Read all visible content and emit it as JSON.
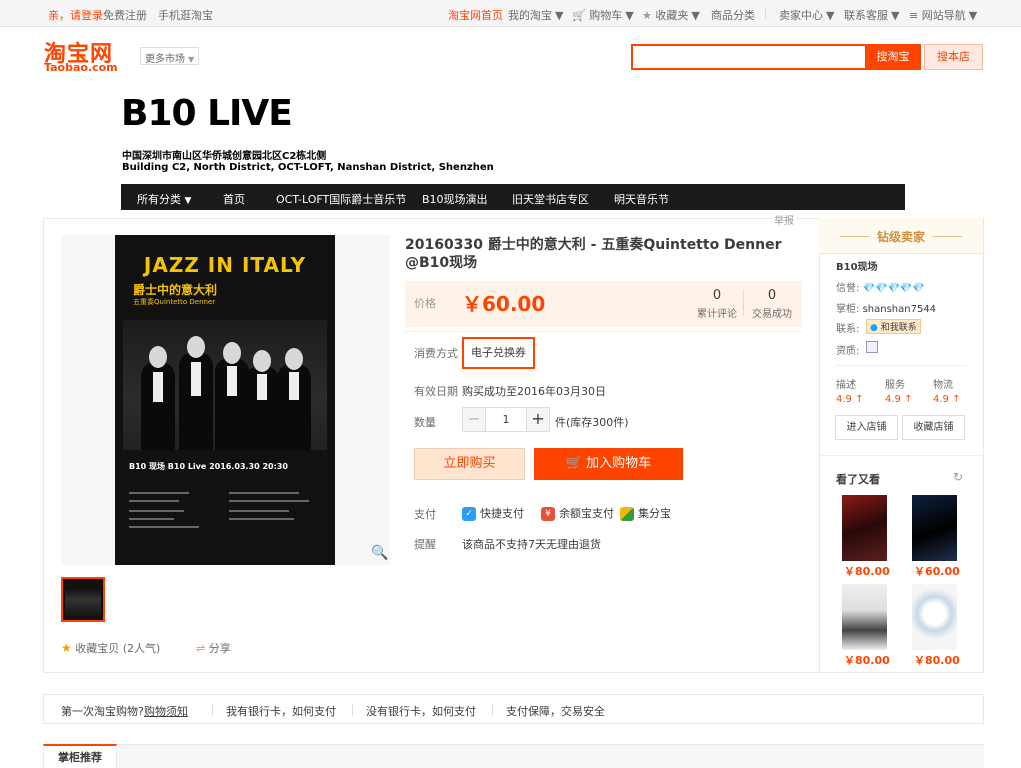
{
  "topbar": {
    "greeting": "亲，请登录",
    "register": "免费注册",
    "mobile": "手机逛淘宝",
    "home": "淘宝网首页",
    "my_taobao": "我的淘宝",
    "cart": "购物车",
    "favorites": "收藏夹",
    "categories": "商品分类",
    "seller_center": "卖家中心",
    "service": "联系客服",
    "site_nav": "网站导航"
  },
  "header": {
    "logo_cn": "淘宝网",
    "logo_en": "Taobao.com",
    "more_market": "更多市场",
    "search_placeholder": "",
    "search_button": "搜淘宝",
    "search_shop_button": "搜本店"
  },
  "shop": {
    "name": "B10 LIVE",
    "address_cn": "中国深圳市南山区华侨城创意园北区C2栋北侧",
    "address_en": "Building C2, North District, OCT-LOFT, Nanshan District, Shenzhen",
    "nav": [
      "所有分类",
      "首页",
      "OCT-LOFT国际爵士音乐节",
      "B10现场演出",
      "旧天堂书店专区",
      "明天音乐节"
    ]
  },
  "product": {
    "report": "举报",
    "title": "20160330 爵士中的意大利 - 五重奏Quintetto Denner @B10现场",
    "price_label": "价格",
    "price": "￥60.00",
    "reviews_count": "0",
    "reviews_label": "累计评论",
    "sales_count": "0",
    "sales_label": "交易成功",
    "consume_label": "消费方式",
    "consume_value": "电子兑换券",
    "validity_label": "有效日期",
    "validity_value": "购买成功至2016年03月30日",
    "qty_label": "数量",
    "qty_minus": "−",
    "qty_value": "1",
    "qty_plus": "+",
    "stock": "件(库存300件)",
    "buy_now": "立即购买",
    "add_cart": "加入购物车",
    "pay_label": "支付",
    "pay_methods": [
      "快捷支付",
      "余额宝支付",
      "集分宝"
    ],
    "remind_label": "提醒",
    "remind_value": "该商品不支持7天无理由退货",
    "favorite": "收藏宝贝 (2人气)",
    "share": "分享"
  },
  "poster": {
    "title": "JAZZ IN ITALY",
    "title_cn": "爵士中的意大利",
    "subtitle": "五重奏Quintetto Denner",
    "info": "B10 现场   B10 Live   2016.03.30   20:30"
  },
  "seller": {
    "level": "钻级卖家",
    "shop_name": "B10现场",
    "credit_label": "信誉:",
    "credit_value": "💎💎💎💎💎",
    "keeper_label": "掌柜:",
    "keeper_value": "shanshan7544",
    "contact_label": "联系:",
    "contact_value": "和我联系",
    "qualification_label": "资质:",
    "scores": [
      {
        "label": "描述",
        "value": "4.9 ↑"
      },
      {
        "label": "服务",
        "value": "4.9 ↑"
      },
      {
        "label": "物流",
        "value": "4.9 ↑"
      }
    ],
    "enter_shop": "进入店铺",
    "fav_shop": "收藏店铺",
    "seen_title": "看了又看",
    "recommendations": [
      {
        "price": "￥80.00"
      },
      {
        "price": "￥60.00"
      },
      {
        "price": "￥80.00"
      },
      {
        "price": "￥80.00"
      }
    ]
  },
  "help": {
    "first_time": "第一次淘宝购物?",
    "guide": "购物须知",
    "with_card": "我有银行卡，如何支付",
    "without_card": "没有银行卡，如何支付",
    "guarantee": "支付保障，交易安全"
  },
  "tabs": {
    "keeper_rec": "掌柜推荐"
  },
  "colors": {
    "brand": "#ff4400",
    "diamond": "#1ea0ff",
    "poster_yellow": "#f5c400"
  }
}
